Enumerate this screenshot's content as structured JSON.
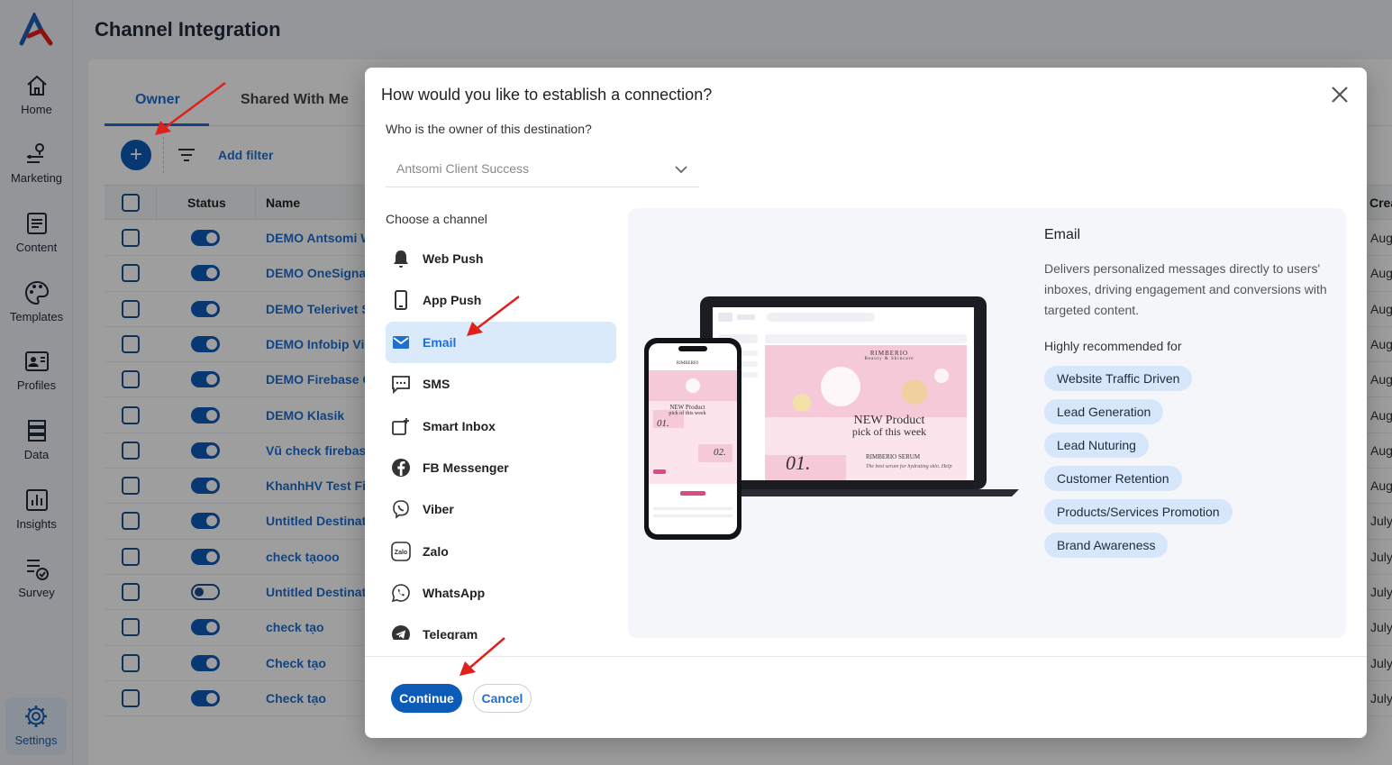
{
  "page": {
    "title": "Channel Integration"
  },
  "sidebar": {
    "items": [
      {
        "label": "Home",
        "icon": "home-icon"
      },
      {
        "label": "Marketing",
        "icon": "marketing-icon"
      },
      {
        "label": "Content",
        "icon": "content-icon"
      },
      {
        "label": "Templates",
        "icon": "palette-icon"
      },
      {
        "label": "Profiles",
        "icon": "profile-card-icon"
      },
      {
        "label": "Data",
        "icon": "data-icon"
      },
      {
        "label": "Insights",
        "icon": "chart-icon"
      },
      {
        "label": "Survey",
        "icon": "survey-icon"
      },
      {
        "label": "Settings",
        "icon": "gear-icon"
      }
    ]
  },
  "tabs": [
    {
      "label": "Owner"
    },
    {
      "label": "Shared With Me"
    }
  ],
  "toolbar": {
    "add_filter": "Add filter",
    "add_label": "+"
  },
  "table": {
    "headers": {
      "status": "Status",
      "name": "Name",
      "created": "Crea"
    },
    "rows": [
      {
        "name": "DEMO Antsomi W",
        "on": true,
        "date": "Aug"
      },
      {
        "name": "DEMO OneSignal",
        "on": true,
        "date": "Aug"
      },
      {
        "name": "DEMO Telerivet S",
        "on": true,
        "date": "Aug"
      },
      {
        "name": "DEMO Infobip Vib",
        "on": true,
        "date": "Aug"
      },
      {
        "name": "DEMO Firebase C",
        "on": true,
        "date": "Aug"
      },
      {
        "name": "DEMO Klasik",
        "on": true,
        "date": "Aug"
      },
      {
        "name": "Vũ check firebase",
        "on": true,
        "date": "Aug"
      },
      {
        "name": "KhanhHV Test Fir",
        "on": true,
        "date": "Aug"
      },
      {
        "name": "Untitled Destinati",
        "on": true,
        "date": "July"
      },
      {
        "name": "check tạooo",
        "on": true,
        "date": "July"
      },
      {
        "name": "Untitled Destinati",
        "on": false,
        "date": "July"
      },
      {
        "name": "check tạo",
        "on": true,
        "date": "July"
      },
      {
        "name": "Check tạo",
        "on": true,
        "date": "July"
      },
      {
        "name": "Check tạo",
        "on": true,
        "date": "July"
      }
    ]
  },
  "modal": {
    "title": "How would you like to establish a connection?",
    "owner_label": "Who is the owner of this destination?",
    "owner_value": "Antsomi Client Success",
    "channel_label": "Choose a channel",
    "channels": [
      {
        "label": "Web Push",
        "icon": "bell-icon"
      },
      {
        "label": "App Push",
        "icon": "phone-icon"
      },
      {
        "label": "Email",
        "icon": "envelope-icon"
      },
      {
        "label": "SMS",
        "icon": "sms-icon"
      },
      {
        "label": "Smart Inbox",
        "icon": "smart-inbox-icon"
      },
      {
        "label": "FB Messenger",
        "icon": "facebook-icon"
      },
      {
        "label": "Viber",
        "icon": "viber-icon"
      },
      {
        "label": "Zalo",
        "icon": "zalo-icon"
      },
      {
        "label": "WhatsApp",
        "icon": "whatsapp-icon"
      },
      {
        "label": "Telegram",
        "icon": "telegram-icon"
      }
    ],
    "selected_channel": "Email",
    "preview": {
      "title": "Email",
      "description": "Delivers personalized messages directly to users' inboxes, driving engagement and conversions with targeted content.",
      "recommended_label": "Highly recommended for",
      "tags": [
        "Website Traffic Driven",
        "Lead Generation",
        "Lead Nuturing",
        "Customer Retention",
        "Products/Services Promotion",
        "Brand Awareness"
      ],
      "mock": {
        "brand": "RIMBERIO",
        "brand_sub": "Beauty & Skincare",
        "headline_1": "NEW Product",
        "headline_2": "pick of this week",
        "num_1": "01.",
        "num_2": "02.",
        "serum": "RIMBERIO SERUM",
        "serum_sub": "The best serum for hydrating skin. Help"
      }
    },
    "continue_label": "Continue",
    "cancel_label": "Cancel"
  },
  "colors": {
    "primary": "#0d5bb8",
    "link": "#1f6fd0",
    "chip": "#d7e7fb",
    "annotation_arrow": "#e0201b"
  }
}
